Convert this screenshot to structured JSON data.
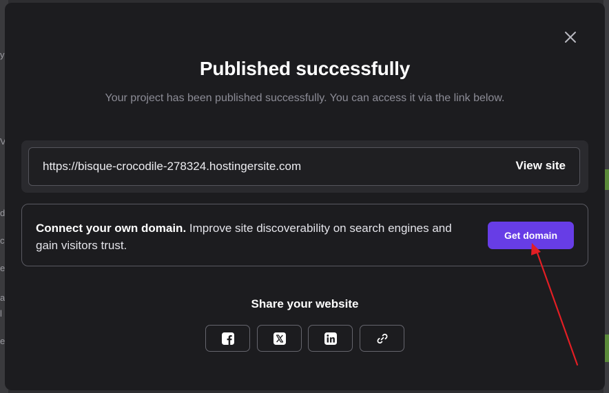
{
  "modal": {
    "title": "Published successfully",
    "subtitle": "Your project has been published successfully. You can access it via the link below."
  },
  "link": {
    "url": "https://bisque-crocodile-278324.hostingersite.com",
    "view_label": "View site"
  },
  "domain": {
    "heading": "Connect your own domain.",
    "text": " Improve site discoverability on search engines and gain visitors trust.",
    "button_label": "Get domain",
    "button_color": "#673de6"
  },
  "share": {
    "title": "Share your website",
    "buttons": [
      {
        "icon": "facebook-icon"
      },
      {
        "icon": "x-twitter-icon"
      },
      {
        "icon": "linkedin-icon"
      },
      {
        "icon": "link-icon"
      }
    ]
  },
  "annotation": {
    "arrow_color": "#e31e24"
  },
  "background_fragments": [
    "y",
    "V",
    "d",
    "c",
    "e",
    "al",
    "l",
    "es"
  ]
}
